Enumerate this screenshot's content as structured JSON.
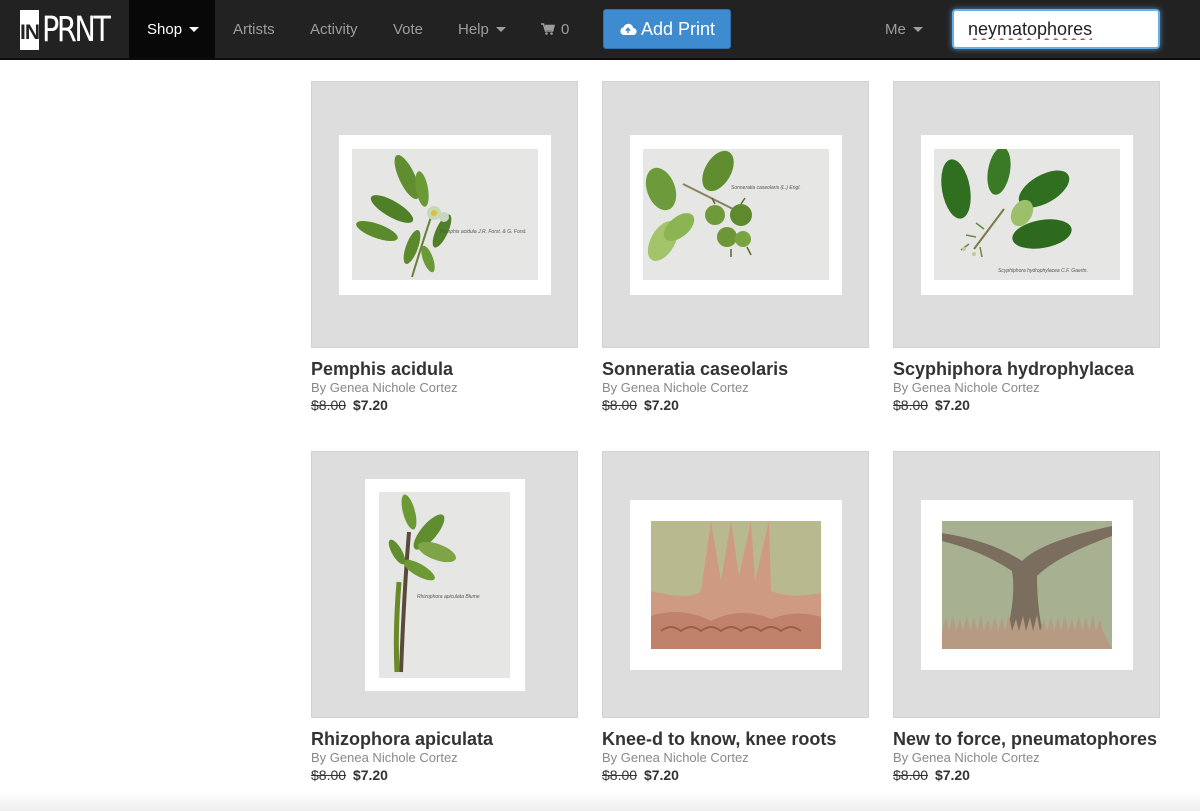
{
  "navbar": {
    "logo_in": "IN",
    "logo_prnt": "PRNT",
    "shop_label": "Shop",
    "artists_label": "Artists",
    "activity_label": "Activity",
    "vote_label": "Vote",
    "help_label": "Help",
    "cart_count": "0",
    "add_print_label": "Add Print",
    "me_label": "Me",
    "search_value": "neymatophores"
  },
  "products": [
    {
      "title": "Pemphis acidula",
      "artist": "By Genea Nichole Cortez",
      "old_price": "$8.00",
      "new_price": "$7.20",
      "caption": "Pemphis acidula J.R. Forst. & G. Forst."
    },
    {
      "title": "Sonneratia caseolaris",
      "artist": "By Genea Nichole Cortez",
      "old_price": "$8.00",
      "new_price": "$7.20",
      "caption": "Sonneratia caseolaris (L.) Engl."
    },
    {
      "title": "Scyphiphora hydrophylacea",
      "artist": "By Genea Nichole Cortez",
      "old_price": "$8.00",
      "new_price": "$7.20",
      "caption": "Scyphiphora hydrophylacea C.F. Gaertn."
    },
    {
      "title": "Rhizophora apiculata",
      "artist": "By Genea Nichole Cortez",
      "old_price": "$8.00",
      "new_price": "$7.20",
      "caption": "Rhizophora apiculata Blume"
    },
    {
      "title": "Knee-d to know, knee roots",
      "artist": "By Genea Nichole Cortez",
      "old_price": "$8.00",
      "new_price": "$7.20"
    },
    {
      "title": "New to force, pneumatophores",
      "artist": "By Genea Nichole Cortez",
      "old_price": "$8.00",
      "new_price": "$7.20"
    }
  ],
  "colors": {
    "navbar_bg": "#222222",
    "nav_active_bg": "#080808",
    "add_print_bg": "#3f8bd0",
    "thumb_bg": "#dddddd"
  },
  "icons": {
    "cart": "shopping-cart-icon",
    "add_print": "cloud-upload-icon",
    "dropdown": "caret-down-icon"
  }
}
